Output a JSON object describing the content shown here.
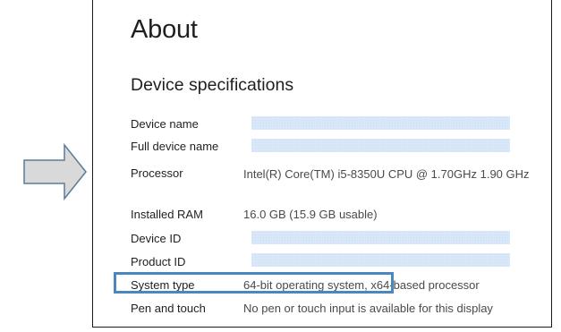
{
  "about": {
    "title": "About",
    "section_title": "Device specifications"
  },
  "specs": {
    "device_name": {
      "label": "Device name",
      "value": ""
    },
    "full_device_name": {
      "label": "Full device name",
      "value": ""
    },
    "processor": {
      "label": "Processor",
      "value": "Intel(R) Core(TM) i5-8350U CPU @ 1.70GHz   1.90 GHz"
    },
    "installed_ram": {
      "label": "Installed RAM",
      "value": "16.0 GB (15.9 GB usable)"
    },
    "device_id": {
      "label": "Device ID",
      "value": ""
    },
    "product_id": {
      "label": "Product ID",
      "value": ""
    },
    "system_type": {
      "label": "System type",
      "value": "64-bit operating system, x64-based processor"
    },
    "pen_and_touch": {
      "label": "Pen and touch",
      "value": "No pen or touch input is available for this display"
    }
  },
  "annotations": {
    "arrow_icon": "right-arrow-icon",
    "highlight_color": "#4a86c0",
    "redaction_color": "#d9e8f8"
  }
}
